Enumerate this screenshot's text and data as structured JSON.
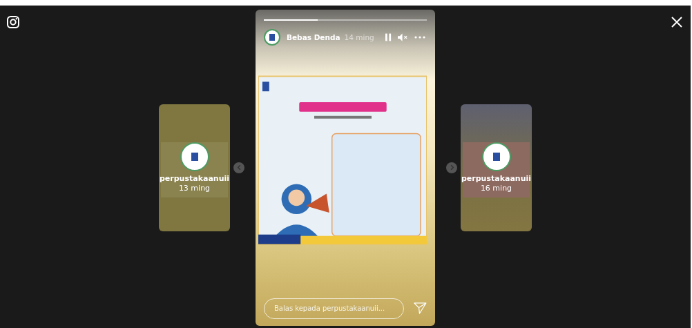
{
  "story": {
    "progress": [
      {
        "level": 0.33
      }
    ],
    "author": "Bebas Denda",
    "time": "14 ming",
    "paused": false,
    "muted": true,
    "reply": {
      "placeholder": "Balas kepada perpustakaanuii..."
    }
  },
  "previous_story": {
    "username": "perpustakaanuii",
    "time": "13 ming"
  },
  "next_story": {
    "username": "perpustakaanuii",
    "time": "16 ming"
  }
}
